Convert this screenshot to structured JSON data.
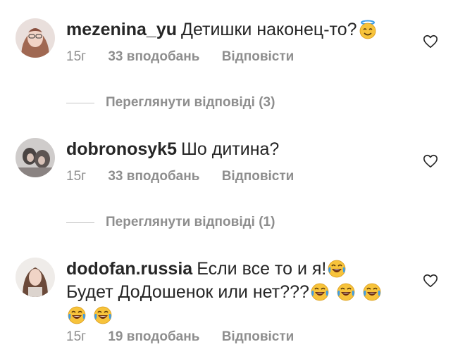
{
  "comments": [
    {
      "username": "mezenina_yu",
      "text": "Детишки наконец-то?",
      "emojis": [
        "smiling-face-with-halo"
      ],
      "time": "15г",
      "likes": "33 вподобань",
      "reply": "Відповісти",
      "view_replies": "Переглянути відповіді (3)"
    },
    {
      "username": "dobronosyk5",
      "text": "Шо дитина?",
      "time": "15г",
      "likes": "33 вподобань",
      "reply": "Відповісти",
      "view_replies": "Переглянути відповіді (1)"
    },
    {
      "username": "dodofan.russia",
      "text_line1": "Если все то и я!",
      "text_line2": "Будет ДоДошенок или нет???",
      "emojis": [
        "face-with-tears-of-joy"
      ],
      "time": "15г",
      "likes": "19 вподобань",
      "reply": "Відповісти"
    }
  ],
  "icons": {
    "like": "heart-outline-icon"
  },
  "colors": {
    "text": "#262626",
    "meta": "#8e8e8e",
    "divider": "#c7c7c7"
  }
}
